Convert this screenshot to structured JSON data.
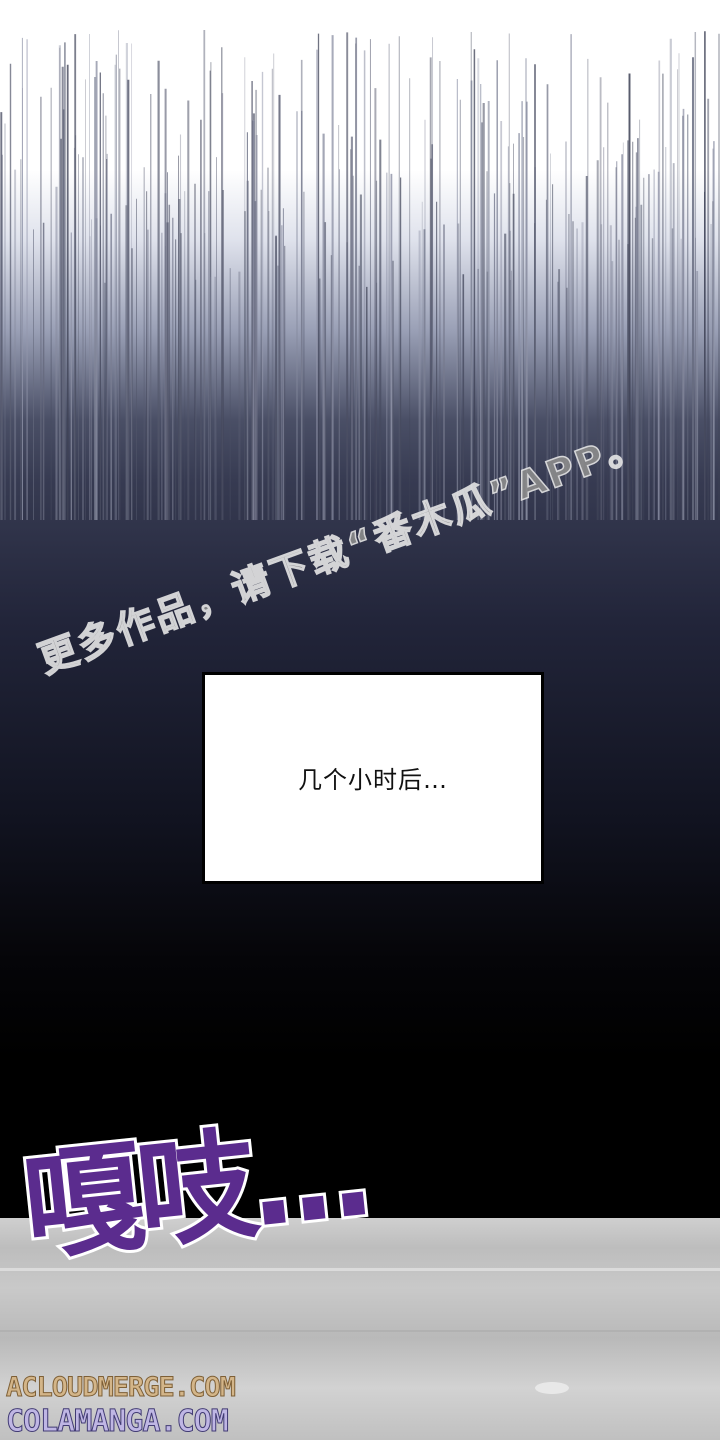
{
  "watermark": {
    "text": "更多作品，请下载“番木瓜”APP。"
  },
  "caption": {
    "text": "几个小时后…"
  },
  "sound_effect": {
    "text": "嘎吱…",
    "color": "#5b2c8e"
  },
  "site_marks": {
    "line1": "ACLOUDMERGE.COM",
    "line2": "COLAMANGA.COM"
  }
}
